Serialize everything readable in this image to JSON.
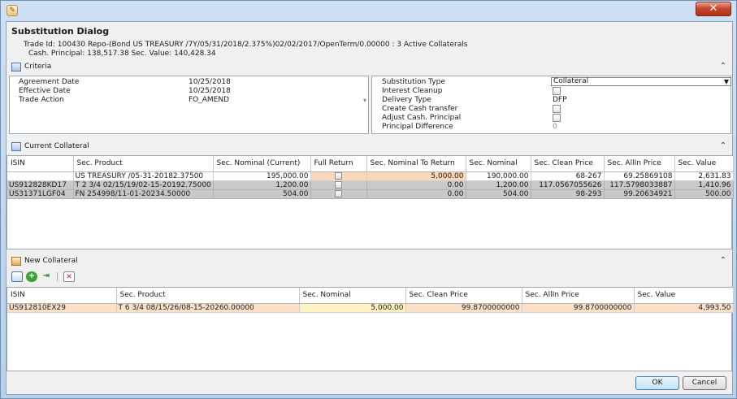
{
  "window": {
    "app_icon_glyph": "✎",
    "close_glyph": "✕"
  },
  "header": {
    "title": "Substitution Dialog",
    "trade_line": "Trade Id: 100430 Repo-(Bond US TREASURY /7Y/05/31/2018/2.375%)02/02/2017/OpenTerm/0.00000 : 3 Active Collaterals",
    "cash_line": "Cash. Principal: 138,517.38  Sec. Value: 140,428.34"
  },
  "criteria": {
    "title": "Criteria",
    "collapse_glyph": "⌃",
    "left": [
      {
        "label": "Agreement Date",
        "value": "10/25/2018"
      },
      {
        "label": "Effective Date",
        "value": "10/25/2018"
      },
      {
        "label": "Trade Action",
        "value": "FO_AMEND"
      }
    ],
    "right": {
      "substitution_type": {
        "label": "Substitution Type",
        "value": "Collateral"
      },
      "interest_cleanup": {
        "label": "Interest Cleanup"
      },
      "delivery_type": {
        "label": "Delivery Type",
        "value": "DFP"
      },
      "create_cash_transfer": {
        "label": "Create Cash transfer"
      },
      "adjust_cash_principal": {
        "label": "Adjust Cash. Principal"
      },
      "principal_difference": {
        "label": "Principal Difference",
        "value": "0"
      }
    }
  },
  "current_collateral": {
    "title": "Current Collateral",
    "columns": [
      "ISIN",
      "Sec. Product",
      "Sec. Nominal (Current)",
      "Full Return",
      "Sec. Nominal To Return",
      "Sec. Nominal",
      "Sec. Clean Price",
      "Sec. AllIn Price",
      "Sec. Value"
    ],
    "rows": [
      {
        "isin": "",
        "product": "US TREASURY /05-31-20182.37500",
        "nominal_current": "195,000.00",
        "to_return": "5,000.00",
        "nominal": "190,000.00",
        "clean": "68-267",
        "allin": "69.25869108",
        "value": "2,631.83"
      },
      {
        "isin": "US912828KD17",
        "product": "T 2 3/4 02/15/19/02-15-20192.75000",
        "nominal_current": "1,200.00",
        "to_return": "0.00",
        "nominal": "1,200.00",
        "clean": "117.0567055626",
        "allin": "117.5798033887",
        "value": "1,410.96"
      },
      {
        "isin": "US31371LGF04",
        "product": "FN 254998/11-01-20234.50000",
        "nominal_current": "504.00",
        "to_return": "0.00",
        "nominal": "504.00",
        "clean": "98-293",
        "allin": "99.20634921",
        "value": "500.00"
      }
    ]
  },
  "new_collateral": {
    "title": "New Collateral",
    "toolbar": [
      "grid-icon",
      "add-icon",
      "import-icon",
      "delete-icon"
    ],
    "columns": [
      "ISIN",
      "Sec. Product",
      "Sec. Nominal",
      "Sec. Clean Price",
      "Sec. AllIn Price",
      "Sec. Value"
    ],
    "rows": [
      {
        "isin": "US912810EX29",
        "product": "T 6 3/4 08/15/26/08-15-20260.00000",
        "nominal": "5,000.00",
        "clean": "99.8700000000",
        "allin": "99.8700000000",
        "value": "4,993.50"
      }
    ]
  },
  "footer": {
    "ok_label": "OK",
    "cancel_label": "Cancel"
  }
}
